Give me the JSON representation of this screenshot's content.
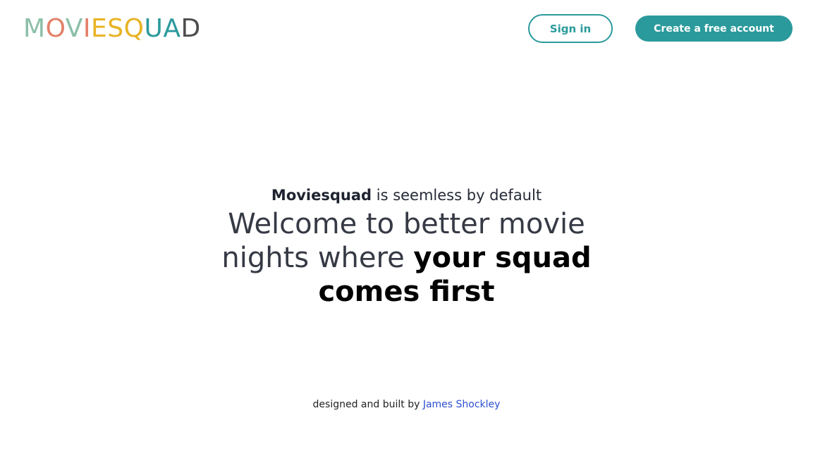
{
  "header": {
    "logo_text": "MOVIESQUAD",
    "logo_colors": [
      "#8bbfa7",
      "#e3806a",
      "#e8b325",
      "#2b9a9c",
      "#4d4d4d"
    ],
    "signin_label": "Sign in",
    "create_label": "Create a free account"
  },
  "hero": {
    "tagline_bold": "Moviesquad",
    "tagline_rest": " is seemless by default",
    "headline_plain": "Welcome to better movie nights where ",
    "headline_bold": "your squad comes first"
  },
  "footer": {
    "credit_text": "designed and built by ",
    "author_link": "James Shockley"
  },
  "colors": {
    "accent": "#2b9a9c",
    "link": "#2b4fcf"
  }
}
